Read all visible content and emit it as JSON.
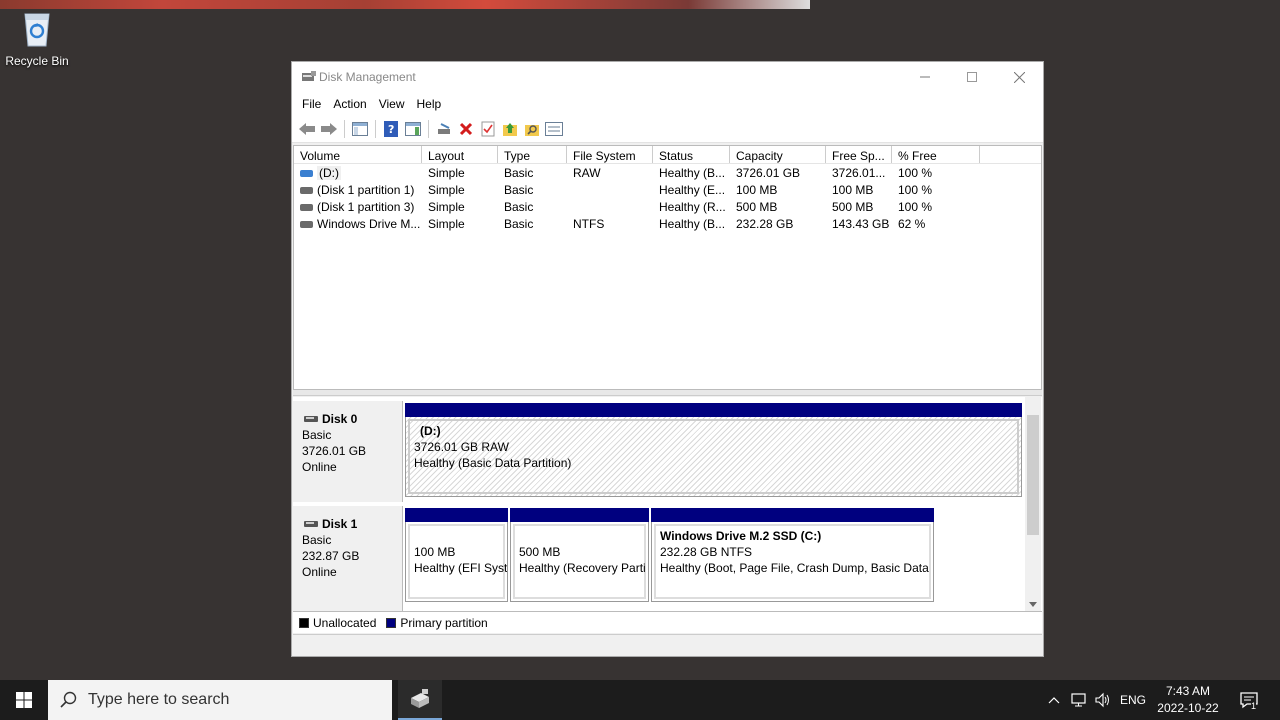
{
  "desktop": {
    "recycle_bin_label": "Recycle Bin"
  },
  "window": {
    "title": "Disk Management",
    "menu": [
      "File",
      "Action",
      "View",
      "Help"
    ]
  },
  "volume_list": {
    "columns": [
      "Volume",
      "Layout",
      "Type",
      "File System",
      "Status",
      "Capacity",
      "Free Sp...",
      "% Free"
    ],
    "rows": [
      {
        "volume": "(D:)",
        "layout": "Simple",
        "type": "Basic",
        "fs": "RAW",
        "status": "Healthy (B...",
        "capacity": "3726.01 GB",
        "free": "3726.01...",
        "pct": "100 %",
        "icon_color": "#3a7fd0"
      },
      {
        "volume": "(Disk 1 partition 1)",
        "layout": "Simple",
        "type": "Basic",
        "fs": "",
        "status": "Healthy (E...",
        "capacity": "100 MB",
        "free": "100 MB",
        "pct": "100 %",
        "icon_color": "#6a6a6a"
      },
      {
        "volume": "(Disk 1 partition 3)",
        "layout": "Simple",
        "type": "Basic",
        "fs": "",
        "status": "Healthy (R...",
        "capacity": "500 MB",
        "free": "500 MB",
        "pct": "100 %",
        "icon_color": "#6a6a6a"
      },
      {
        "volume": "Windows Drive M...",
        "layout": "Simple",
        "type": "Basic",
        "fs": "NTFS",
        "status": "Healthy (B...",
        "capacity": "232.28 GB",
        "free": "143.43 GB",
        "pct": "62 %",
        "icon_color": "#6a6a6a"
      }
    ]
  },
  "disks": {
    "disk0": {
      "name": "Disk 0",
      "type": "Basic",
      "size": "3726.01 GB",
      "state": "Online",
      "partition": {
        "title": "(D:)",
        "line1": "3726.01 GB RAW",
        "line2": "Healthy (Basic Data Partition)"
      }
    },
    "disk1": {
      "name": "Disk 1",
      "type": "Basic",
      "size": "232.87 GB",
      "state": "Online",
      "partitions": [
        {
          "title": "",
          "line1": "100 MB",
          "line2": "Healthy (EFI Syst"
        },
        {
          "title": "",
          "line1": "500 MB",
          "line2": "Healthy (Recovery Parti"
        },
        {
          "title": "Windows Drive M.2 SSD  (C:)",
          "line1": "232.28 GB NTFS",
          "line2": "Healthy (Boot, Page File, Crash Dump, Basic Data P"
        }
      ]
    }
  },
  "legend": {
    "unallocated": "Unallocated",
    "primary": "Primary partition",
    "unallocated_color": "#000000",
    "primary_color": "#00007f"
  },
  "taskbar": {
    "search_placeholder": "Type here to search",
    "language": "ENG",
    "time": "7:43 AM",
    "date": "2022-10-22",
    "notification_count": "1"
  }
}
